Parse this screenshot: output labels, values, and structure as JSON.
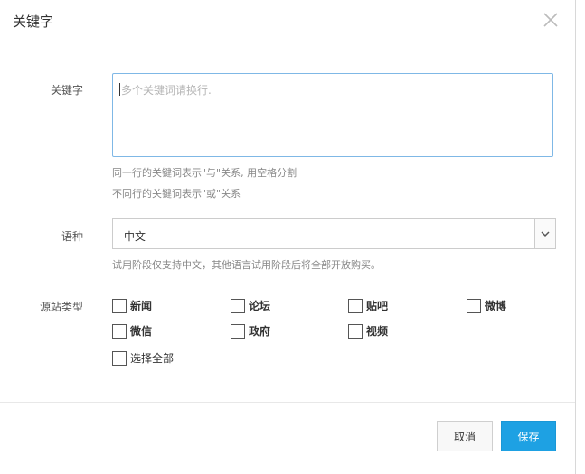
{
  "dialog": {
    "title": "关键字",
    "close_icon": "close-icon"
  },
  "form": {
    "keyword_label": "关键字",
    "keyword_placeholder": "多个关键词请换行.",
    "hint_line1": "同一行的关键词表示\"与\"关系, 用空格分割",
    "hint_line2": "不同行的关键词表示\"或\"关系",
    "language_label": "语种",
    "language_value": "中文",
    "language_hint": "试用阶段仅支持中文，其他语言试用阶段后将全部开放购买。",
    "source_label": "源站类型",
    "source_types": [
      "新闻",
      "论坛",
      "贴吧",
      "微博",
      "微信",
      "政府",
      "视频"
    ],
    "select_all": "选择全部"
  },
  "buttons": {
    "cancel": "取消",
    "save": "保存"
  },
  "colors": {
    "primary": "#1ea1e3",
    "focus_border": "#7fb8e6"
  }
}
